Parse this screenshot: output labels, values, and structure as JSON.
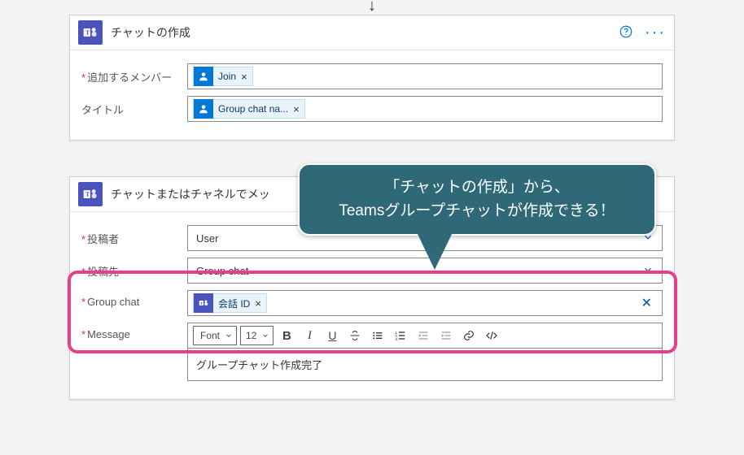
{
  "card1": {
    "title": "チャットの作成",
    "rows": {
      "members": {
        "label": "追加するメンバー",
        "token_label": "Join"
      },
      "title": {
        "label": "タイトル",
        "token_label": "Group chat na..."
      }
    }
  },
  "card2": {
    "title": "チャットまたはチャネルでメッ",
    "rows": {
      "poster": {
        "label": "投稿者",
        "value": "User"
      },
      "postin": {
        "label": "投稿先",
        "value": "Group chat"
      },
      "gchat": {
        "label": "Group chat",
        "token_label": "会話 ID"
      },
      "message": {
        "label": "Message",
        "font_label": "Font",
        "size_label": "12",
        "body": "グループチャット作成完了"
      }
    }
  },
  "callout": {
    "line1": "「チャットの作成」から、",
    "line2": "Teamsグループチャットが作成できる！"
  }
}
